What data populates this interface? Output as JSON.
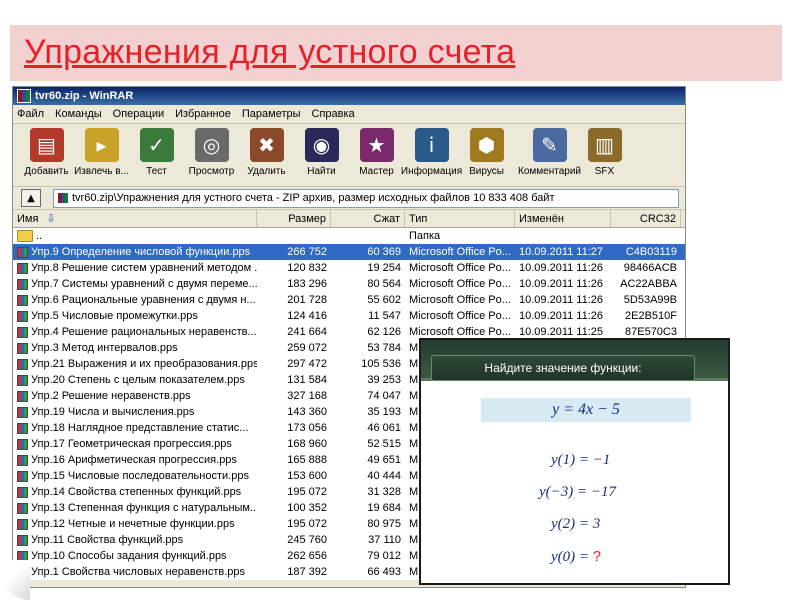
{
  "slide": {
    "title": "Упражнения для устного счета"
  },
  "window": {
    "title": "tvr60.zip - WinRAR",
    "menu": [
      "Файл",
      "Команды",
      "Операции",
      "Избранное",
      "Параметры",
      "Справка"
    ],
    "toolbar": [
      {
        "label": "Добавить",
        "icon": "books-stack-icon",
        "color": "#b23a2a",
        "glyph": "▤"
      },
      {
        "label": "Извлечь в...",
        "icon": "folder-extract-icon",
        "color": "#c9a227",
        "glyph": "▸"
      },
      {
        "label": "Тест",
        "icon": "checkmark-icon",
        "color": "#3a7a3a",
        "glyph": "✓"
      },
      {
        "label": "Просмотр",
        "icon": "glasses-icon",
        "color": "#6a6a6a",
        "glyph": "◎"
      },
      {
        "label": "Удалить",
        "icon": "trash-icon",
        "color": "#8a4a2a",
        "glyph": "✖"
      },
      {
        "label": "Найти",
        "icon": "binoculars-icon",
        "color": "#2a2a5a",
        "glyph": "◉"
      },
      {
        "label": "Мастер",
        "icon": "wizard-icon",
        "color": "#7a2a6a",
        "glyph": "★"
      },
      {
        "label": "Информация",
        "icon": "info-icon",
        "color": "#2a5a8a",
        "glyph": "i"
      },
      {
        "label": "Вирусы",
        "icon": "virus-scan-icon",
        "color": "#a07a20",
        "glyph": "⬢"
      },
      {
        "label": "Комментарий",
        "icon": "comment-icon",
        "color": "#4a6aa0",
        "glyph": "✎"
      },
      {
        "label": "SFX",
        "icon": "sfx-archive-icon",
        "color": "#8a6a2a",
        "glyph": "▥"
      }
    ],
    "path": "tvr60.zip\\Упражнения для устного счета - ZIP архив, размер исходных файлов 10 833 408 байт",
    "columns": {
      "name": "Имя",
      "size": "Размер",
      "packed": "Сжат",
      "type": "Тип",
      "modified": "Изменён",
      "crc": "CRC32"
    },
    "parent_row": {
      "name": "..",
      "type": "Папка"
    },
    "rows": [
      {
        "name": "Упр.9 Определение числовой функции.pps",
        "size": "266 752",
        "packed": "60 369",
        "type": "Microsoft Office Po...",
        "modified": "10.09.2011 11:27",
        "crc": "C4B03119",
        "selected": true
      },
      {
        "name": "Упр.8 Решение систем уравнений методом ...",
        "size": "120 832",
        "packed": "19 254",
        "type": "Microsoft Office Po...",
        "modified": "10.09.2011 11:26",
        "crc": "98466ACB"
      },
      {
        "name": "Упр.7 Системы уравнений с двумя переме...",
        "size": "183 296",
        "packed": "80 564",
        "type": "Microsoft Office Po...",
        "modified": "10.09.2011 11:26",
        "crc": "AC22ABBA"
      },
      {
        "name": "Упр.6 Рациональные уравнения с двумя н...",
        "size": "201 728",
        "packed": "55 602",
        "type": "Microsoft Office Po...",
        "modified": "10.09.2011 11:26",
        "crc": "5D53A99B"
      },
      {
        "name": "Упр.5 Числовые промежутки.pps",
        "size": "124 416",
        "packed": "11 547",
        "type": "Microsoft Office Po...",
        "modified": "10.09.2011 11:26",
        "crc": "2E2B510F"
      },
      {
        "name": "Упр.4 Решение рациональных неравенств....",
        "size": "241 664",
        "packed": "62 126",
        "type": "Microsoft Office Po...",
        "modified": "10.09.2011 11:25",
        "crc": "87E570C3"
      },
      {
        "name": "Упр.3 Метод интервалов.pps",
        "size": "259 072",
        "packed": "53 784",
        "type": "M",
        "modified": "",
        "crc": ""
      },
      {
        "name": "Упр.21 Выражения и их преобразования.pps",
        "size": "297 472",
        "packed": "105 536",
        "type": "M",
        "modified": "",
        "crc": ""
      },
      {
        "name": "Упр.20 Степень с целым показателем.pps",
        "size": "131 584",
        "packed": "39 253",
        "type": "M",
        "modified": "",
        "crc": ""
      },
      {
        "name": "Упр.2 Решение неравенств.pps",
        "size": "327 168",
        "packed": "74 047",
        "type": "M",
        "modified": "",
        "crc": ""
      },
      {
        "name": "Упр.19 Числа и вычисления.pps",
        "size": "143 360",
        "packed": "35 193",
        "type": "M",
        "modified": "",
        "crc": ""
      },
      {
        "name": "Упр.18  Наглядное представление статис...",
        "size": "173 056",
        "packed": "46 061",
        "type": "M",
        "modified": "",
        "crc": ""
      },
      {
        "name": "Упр.17 Геометрическая прогрессия.pps",
        "size": "168 960",
        "packed": "52 515",
        "type": "M",
        "modified": "",
        "crc": ""
      },
      {
        "name": "Упр.16 Арифметическая прогрессия.pps",
        "size": "165 888",
        "packed": "49 651",
        "type": "M",
        "modified": "",
        "crc": ""
      },
      {
        "name": "Упр.15 Числовые последовательности.pps",
        "size": "153 600",
        "packed": "40 444",
        "type": "M",
        "modified": "",
        "crc": ""
      },
      {
        "name": "Упр.14 Свойства степенных функций.pps",
        "size": "195 072",
        "packed": "31 328",
        "type": "M",
        "modified": "",
        "crc": ""
      },
      {
        "name": "Упр.13 Степенная функция с натуральным...",
        "size": "100 352",
        "packed": "19 684",
        "type": "M",
        "modified": "",
        "crc": ""
      },
      {
        "name": "Упр.12 Четные и нечетные функции.pps",
        "size": "195 072",
        "packed": "80 975",
        "type": "M",
        "modified": "",
        "crc": ""
      },
      {
        "name": "Упр.11 Свойства функций.pps",
        "size": "245 760",
        "packed": "37 110",
        "type": "M",
        "modified": "",
        "crc": ""
      },
      {
        "name": "Упр.10 Способы задания функций.pps",
        "size": "262 656",
        "packed": "79 012",
        "type": "M",
        "modified": "",
        "crc": ""
      },
      {
        "name": "Упр.1 Свойства числовых неравенств.pps",
        "size": "187 392",
        "packed": "66 493",
        "type": "M",
        "modified": "",
        "crc": ""
      }
    ]
  },
  "exercise": {
    "task": "Найдите значение функции:",
    "function": "y = 4x − 5",
    "equations": [
      {
        "text": "y(1) = −1",
        "answer": ""
      },
      {
        "text": "y(−3) = −17",
        "answer": ""
      },
      {
        "text": "y(2) = 3",
        "answer": ""
      },
      {
        "text": "y(0) = ",
        "answer": "?"
      }
    ]
  }
}
